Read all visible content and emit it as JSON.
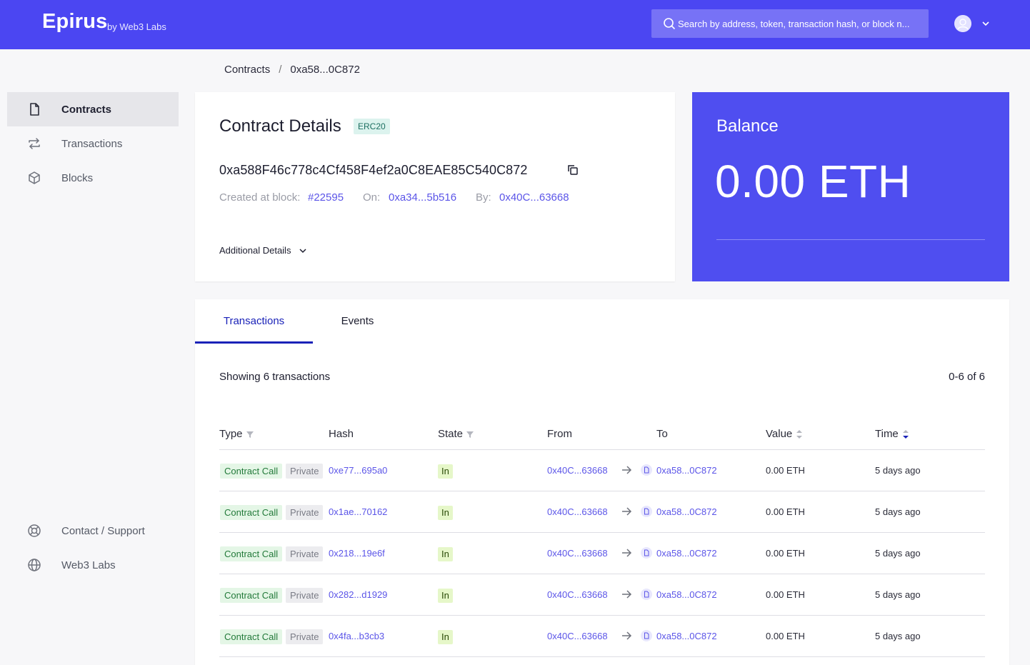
{
  "header": {
    "logo": "Epirus",
    "logo_sub": "by Web3 Labs",
    "search_placeholder": "Search by address, token, transaction hash, or block n...",
    "accent": "#4b46f2"
  },
  "breadcrumb": {
    "root": "Contracts",
    "separator": "/",
    "current": "0xa58...0C872"
  },
  "sidebar": {
    "items": [
      {
        "label": "Contracts",
        "icon": "file-icon",
        "active": true
      },
      {
        "label": "Transactions",
        "icon": "swap-icon",
        "active": false
      },
      {
        "label": "Blocks",
        "icon": "cube-icon",
        "active": false
      }
    ],
    "footer": [
      {
        "label": "Contact / Support",
        "icon": "lifebuoy-icon"
      },
      {
        "label": "Web3 Labs",
        "icon": "globe-icon"
      }
    ]
  },
  "contract": {
    "title": "Contract Details",
    "badge": "ERC20",
    "address": "0xa588F46c778c4Cf458F4ef2a0C8EAE85C540C872",
    "created_label": "Created at block:",
    "created_block": "#22595",
    "on_label": "On:",
    "on_value": "0xa34...5b516",
    "by_label": "By:",
    "by_value": "0x40C...63668",
    "additional": "Additional Details"
  },
  "balance": {
    "label": "Balance",
    "value": "0.00 ETH",
    "color": "#4f4ef0"
  },
  "tabs": [
    {
      "label": "Transactions",
      "active": true
    },
    {
      "label": "Events",
      "active": false
    }
  ],
  "transactions": {
    "showing": "Showing 6 transactions",
    "pager": "0-6 of 6",
    "columns": [
      "Type",
      "Hash",
      "State",
      "From",
      "To",
      "Value",
      "Time"
    ],
    "rows": [
      {
        "type": "Contract Call",
        "visibility": "Private",
        "hash": "0xe77...695a0",
        "state": "In",
        "from": "0x40C...63668",
        "to": "0xa58...0C872",
        "value": "0.00 ETH",
        "time": "5 days ago"
      },
      {
        "type": "Contract Call",
        "visibility": "Private",
        "hash": "0x1ae...70162",
        "state": "In",
        "from": "0x40C...63668",
        "to": "0xa58...0C872",
        "value": "0.00 ETH",
        "time": "5 days ago"
      },
      {
        "type": "Contract Call",
        "visibility": "Private",
        "hash": "0x218...19e6f",
        "state": "In",
        "from": "0x40C...63668",
        "to": "0xa58...0C872",
        "value": "0.00 ETH",
        "time": "5 days ago"
      },
      {
        "type": "Contract Call",
        "visibility": "Private",
        "hash": "0x282...d1929",
        "state": "In",
        "from": "0x40C...63668",
        "to": "0xa58...0C872",
        "value": "0.00 ETH",
        "time": "5 days ago"
      },
      {
        "type": "Contract Call",
        "visibility": "Private",
        "hash": "0x4fa...b3cb3",
        "state": "In",
        "from": "0x40C...63668",
        "to": "0xa58...0C872",
        "value": "0.00 ETH",
        "time": "5 days ago"
      }
    ]
  }
}
